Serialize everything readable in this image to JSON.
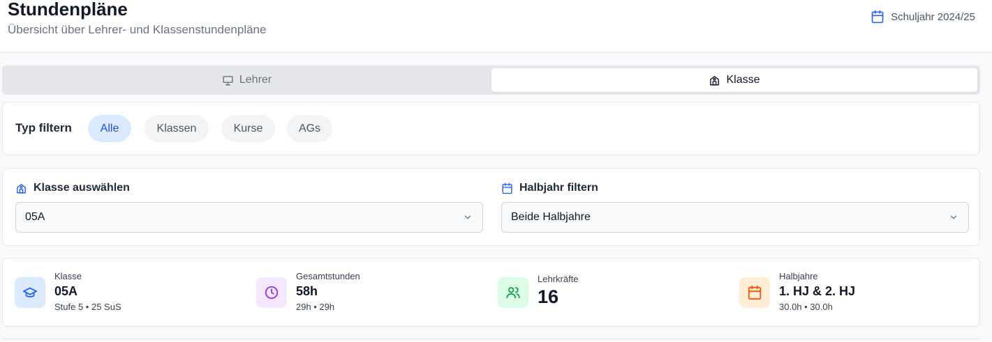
{
  "header": {
    "title": "Stundenpläne",
    "subtitle": "Übersicht über Lehrer- und Klassenstundenpläne",
    "year": "Schuljahr 2024/25",
    "year_icon": "calendar-icon"
  },
  "tabs": [
    {
      "label": "Lehrer",
      "icon": "presentation-icon",
      "active": false
    },
    {
      "label": "Klasse",
      "icon": "school-icon",
      "active": true
    }
  ],
  "filter": {
    "label": "Typ filtern",
    "options": [
      "Alle",
      "Klassen",
      "Kurse",
      "AGs"
    ],
    "selected": "Alle"
  },
  "selects": {
    "klasse": {
      "label": "Klasse auswählen",
      "value": "05A",
      "icon": "school-icon"
    },
    "halbjahr": {
      "label": "Halbjahr filtern",
      "value": "Beide Halbjahre",
      "icon": "calendar-icon"
    }
  },
  "stats": [
    {
      "label": "Klasse",
      "value": "05A",
      "sub": "Stufe 5 • 25 SuS",
      "icon": "graduation-cap-icon",
      "color": "#2563eb",
      "bg": "#dbeafe"
    },
    {
      "label": "Gesamtstunden",
      "value": "58h",
      "sub": "29h • 29h",
      "icon": "clock-icon",
      "color": "#9333ea",
      "bg": "#f3e8ff"
    },
    {
      "label": "Lehrkräfte",
      "value": "16",
      "sub": "",
      "icon": "users-icon",
      "color": "#16a34a",
      "bg": "#dcfce7"
    },
    {
      "label": "Halbjahre",
      "value": "1. HJ & 2. HJ",
      "sub": "30.0h • 30.0h",
      "icon": "calendar-icon",
      "color": "#ea580c",
      "bg": "#ffedd5"
    }
  ],
  "colors": {
    "accent": "#2563eb",
    "active_pill_bg": "#dbeafe"
  }
}
